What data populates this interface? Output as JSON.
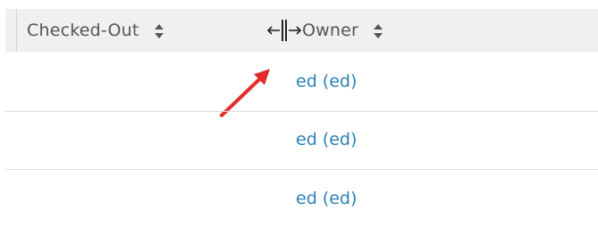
{
  "columns": {
    "checked_out": "Checked-Out",
    "owner": "Owner"
  },
  "rows": [
    {
      "owner": "ed (ed)"
    },
    {
      "owner": "ed (ed)"
    },
    {
      "owner": "ed (ed)"
    }
  ],
  "colors": {
    "header_bg": "#f0f0f0",
    "header_text": "#555555",
    "link": "#2a80b9",
    "annotation_arrow": "#e32b2b",
    "separator": "#dddddd"
  },
  "icons": {
    "sort": "sort-icon",
    "resize_cursor": "column-resize-cursor-icon",
    "annotation": "red-pointer-arrow-icon"
  }
}
